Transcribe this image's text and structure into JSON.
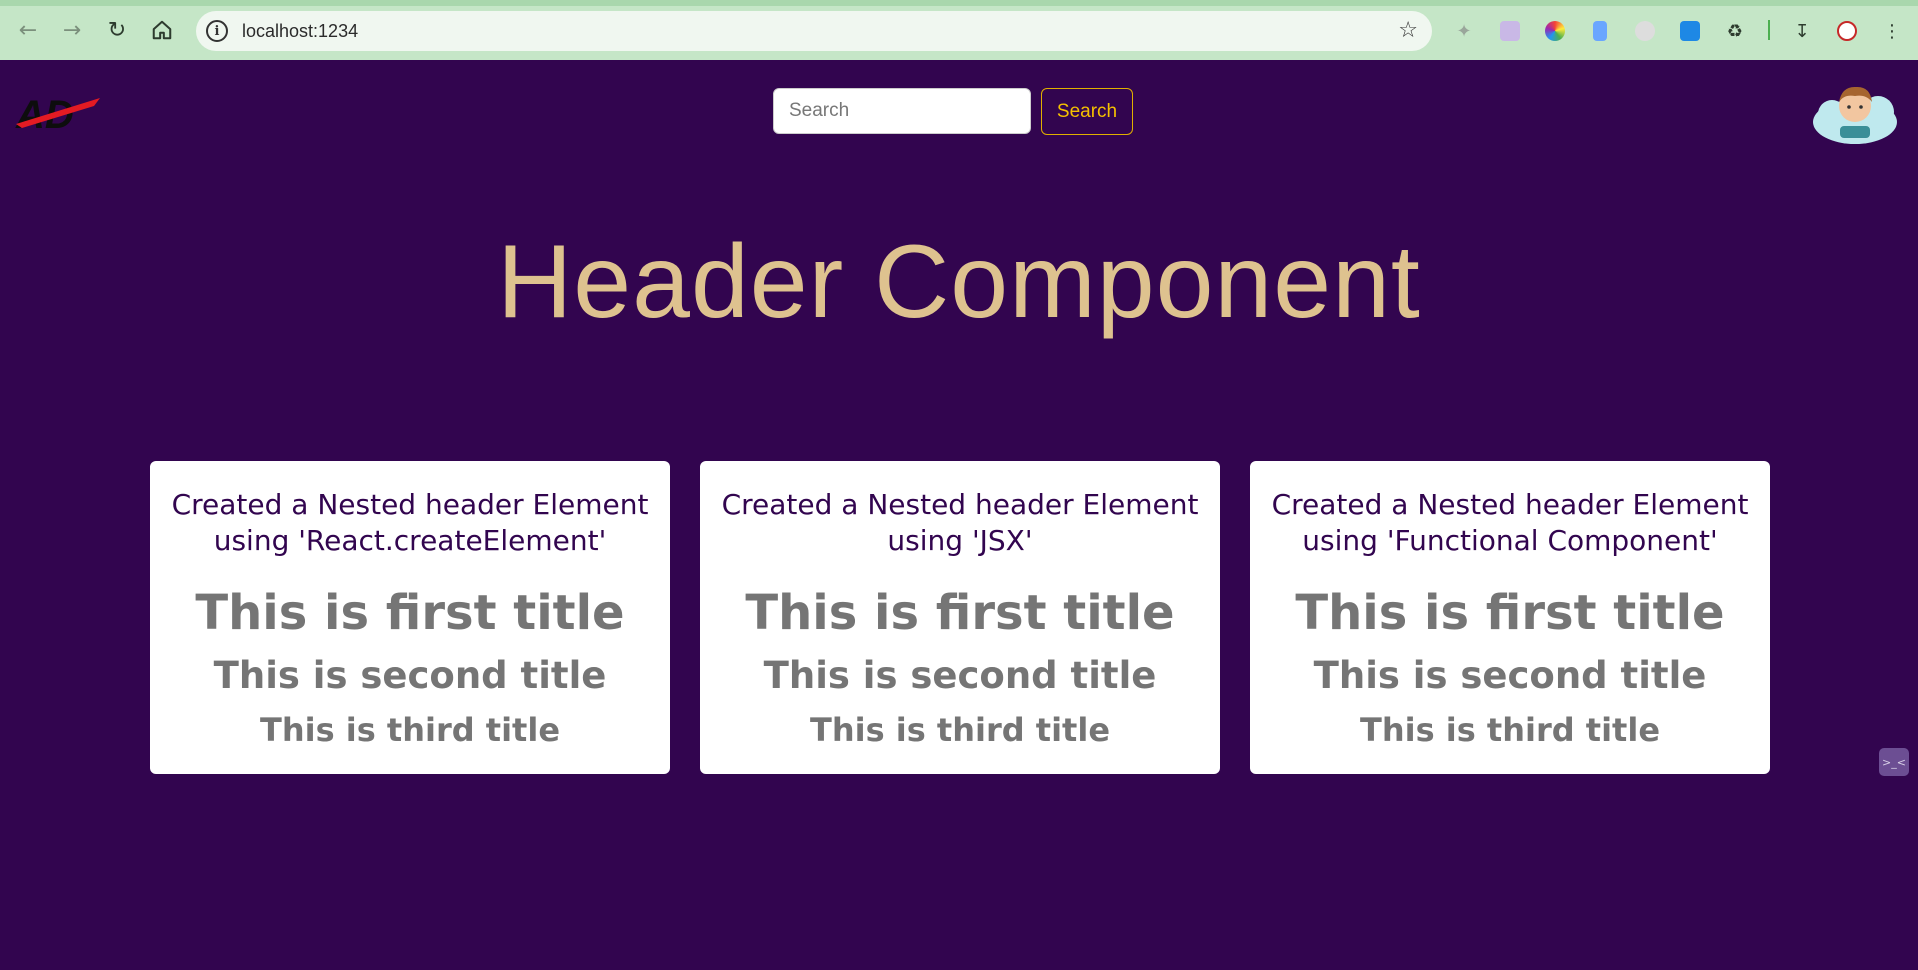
{
  "browser": {
    "url": "localhost:1234",
    "icons": {
      "back": "arrow-left-icon",
      "forward": "arrow-right-icon",
      "reload": "reload-icon",
      "home": "home-icon",
      "info": "info-icon",
      "bookmark": "star-icon",
      "downloads": "download-icon",
      "menu": "kebab-menu-icon"
    }
  },
  "header": {
    "logo_text": "AD",
    "search": {
      "placeholder": "Search",
      "value": "",
      "button_label": "Search"
    }
  },
  "main": {
    "title": "Header Component",
    "cards": [
      {
        "heading": "Created a Nested header Element using 'React.createElement'",
        "title1": "This is first title",
        "title2": "This is second title",
        "title3": "This is third title"
      },
      {
        "heading": "Created a Nested header Element using 'JSX'",
        "title1": "This is first title",
        "title2": "This is second title",
        "title3": "This is third title"
      },
      {
        "heading": "Created a Nested header Element using 'Functional Component'",
        "title1": "This is first title",
        "title2": "This is second title",
        "title3": "This is third title"
      }
    ]
  },
  "colors": {
    "background": "#32054f",
    "title": "#dec28f",
    "search_button": "#f5c000",
    "card_heading": "#32054f",
    "card_text": "#757575"
  }
}
